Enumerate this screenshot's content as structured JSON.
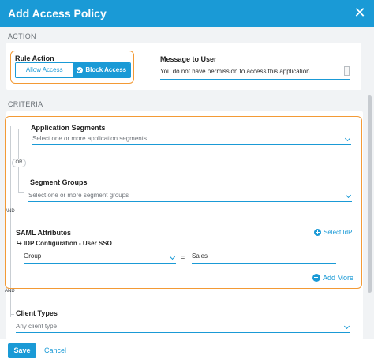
{
  "header": {
    "title": "Add Access Policy",
    "close_icon": "close-icon"
  },
  "colors": {
    "accent": "#1a9ad6",
    "highlight": "#f39a35"
  },
  "action": {
    "section_label": "ACTION",
    "rule_action_label": "Rule Action",
    "allow_label": "Allow Access",
    "block_label": "Block Access",
    "selected": "Block Access",
    "message_label": "Message to User",
    "message_value": "You do not have permission to access this application."
  },
  "criteria": {
    "section_label": "CRITERIA",
    "app_segments": {
      "label": "Application Segments",
      "placeholder": "Select one or more application segments"
    },
    "or_label": "OR",
    "segment_groups": {
      "label": "Segment Groups",
      "placeholder": "Select one or more segment groups"
    },
    "and_label_1": "AND",
    "saml": {
      "label": "SAML Attributes",
      "select_idp": "Select IdP",
      "idp_config": "IDP Configuration - User SSO",
      "attribute": "Group",
      "operator": "=",
      "value": "Sales",
      "add_more": "Add More"
    },
    "and_label_2": "AND",
    "client_types": {
      "label": "Client Types",
      "placeholder": "Any client type"
    }
  },
  "footer": {
    "save_label": "Save",
    "cancel_label": "Cancel"
  }
}
